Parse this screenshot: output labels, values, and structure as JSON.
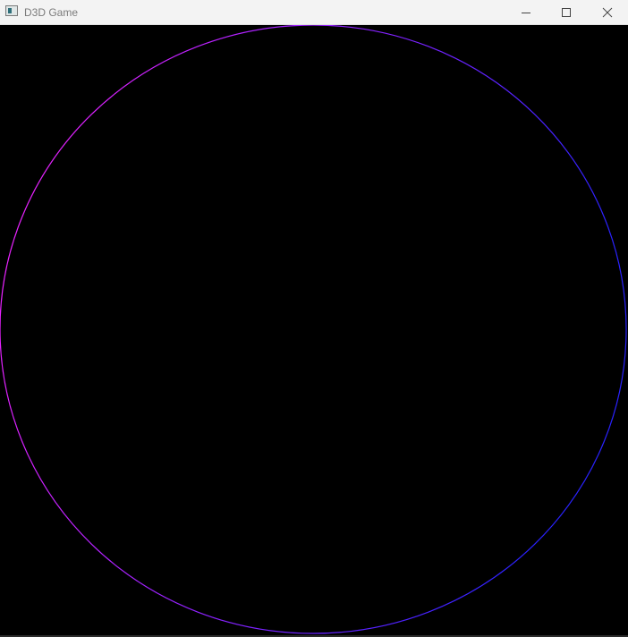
{
  "window": {
    "title": "D3D Game",
    "app_icon": "window-app-icon",
    "controls": [
      "minimize-icon",
      "maximize-icon",
      "close-icon"
    ]
  },
  "scene": {
    "background_color": "#000000",
    "circle": {
      "gradient_start_color": "#ff22ff",
      "gradient_end_color": "#2a22ff"
    }
  }
}
